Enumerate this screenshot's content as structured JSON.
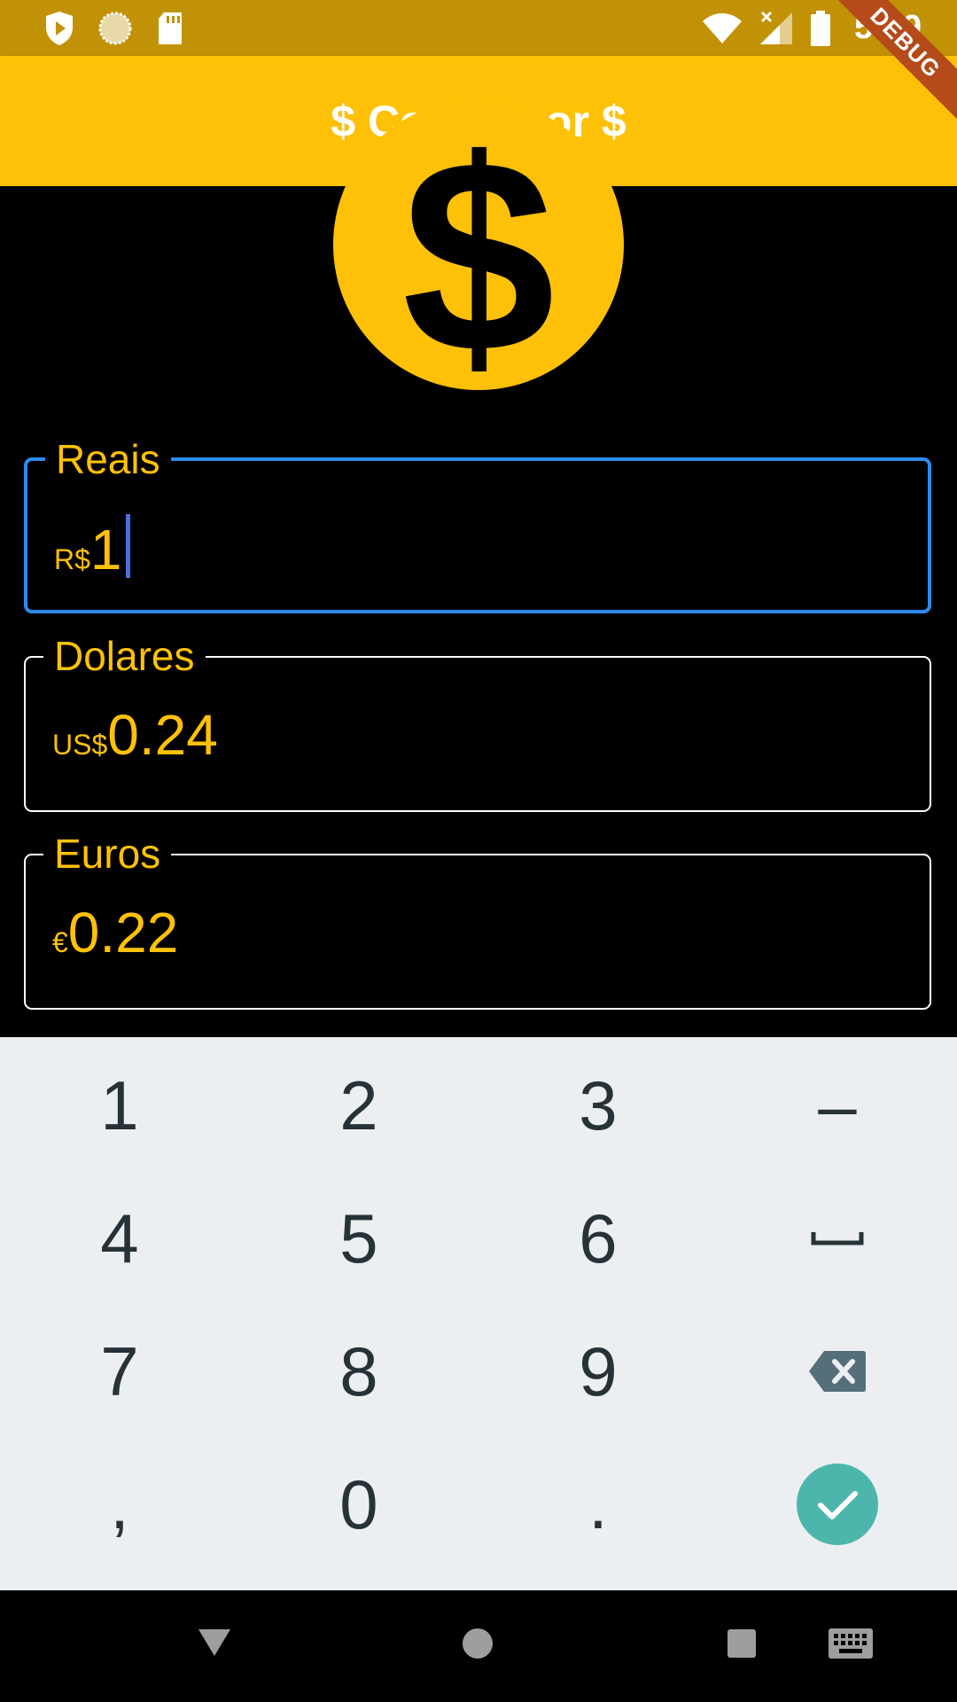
{
  "status_bar": {
    "time": "5:29",
    "icons": [
      "play-shield-icon",
      "loading-circle-icon",
      "sd-card-icon",
      "wifi-icon",
      "no-signal-icon",
      "battery-icon"
    ]
  },
  "debug_banner": "DEBUG",
  "app_bar": {
    "title": "$ Conversor $"
  },
  "colors": {
    "primary": "#FFC107",
    "status_bar": "#C29206",
    "focus": "#2D8CEB",
    "keyboard_bg": "#ECEFF1",
    "done_key": "#4DB6AC"
  },
  "fields": [
    {
      "label": "Reais",
      "prefix": "R$",
      "value": "1",
      "focused": true
    },
    {
      "label": "Dolares",
      "prefix": "US$",
      "value": "0.24",
      "focused": false
    },
    {
      "label": "Euros",
      "prefix": "€",
      "value": "0.22",
      "focused": false
    }
  ],
  "keyboard": {
    "rows": [
      [
        "1",
        "2",
        "3",
        "–"
      ],
      [
        "4",
        "5",
        "6",
        "␣"
      ],
      [
        "7",
        "8",
        "9",
        "backspace-icon"
      ],
      [
        ",",
        "0",
        ".",
        "check-icon"
      ]
    ]
  },
  "nav_bar": {
    "icons": [
      "back-icon",
      "home-icon",
      "recents-icon",
      "keyboard-icon"
    ]
  }
}
